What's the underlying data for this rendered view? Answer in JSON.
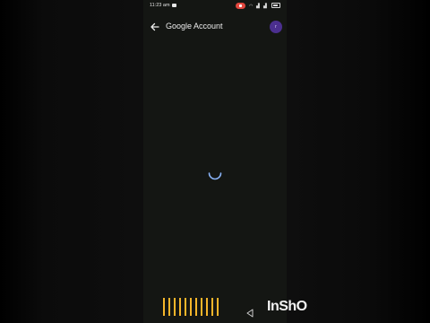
{
  "status_bar": {
    "time": "11:23 am"
  },
  "app_bar": {
    "title": "Google Account",
    "avatar_initial": "r"
  },
  "content": {
    "loading_indicator": "spinner-icon"
  },
  "watermark": {
    "text": "InShO"
  },
  "colors": {
    "screen_bg": "#141613",
    "accent": "#4b2f8f",
    "spinner": "#8ab4f8",
    "barcode": "#f5b52a"
  }
}
